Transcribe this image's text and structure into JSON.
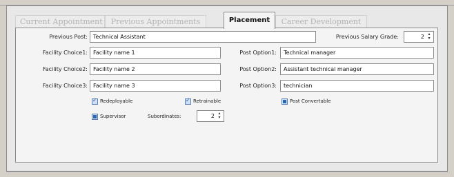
{
  "tabs": [
    {
      "label": "Current Appointment",
      "active": false
    },
    {
      "label": "Previous Appointments",
      "active": false
    },
    {
      "label": "Placement",
      "active": true
    },
    {
      "label": "Career Development",
      "active": false
    }
  ],
  "form": {
    "previous_post": {
      "label": "Previous Post:",
      "value": "Technical Assistant"
    },
    "previous_salary_grade": {
      "label": "Previous Salary Grade:",
      "value": "2"
    },
    "facility_choice_1": {
      "label": "Facility Choice1:",
      "value": "Facility name 1"
    },
    "facility_choice_2": {
      "label": "Facility Choice2:",
      "value": "Facility name 2"
    },
    "facility_choice_3": {
      "label": "Facility Choice3:",
      "value": "Facility name 3"
    },
    "post_option_1": {
      "label": "Post Option1:",
      "value": "Technical manager"
    },
    "post_option_2": {
      "label": "Post Option2:",
      "value": "Assistant technical manager"
    },
    "post_option_3": {
      "label": "Post Option3:",
      "value": "technician"
    },
    "redeployable": {
      "label": "Redeployable",
      "checked": true
    },
    "retrainable": {
      "label": "Retrainable",
      "checked": true
    },
    "post_convertable": {
      "label": "Post Convertable",
      "state": "indeterminate"
    },
    "supervisor": {
      "label": "Supervisor",
      "state": "indeterminate"
    },
    "subordinates": {
      "label": "Subordinates:",
      "value": "2"
    }
  },
  "icons": {
    "spin_up": "up-arrow-icon",
    "spin_down": "down-arrow-icon"
  }
}
